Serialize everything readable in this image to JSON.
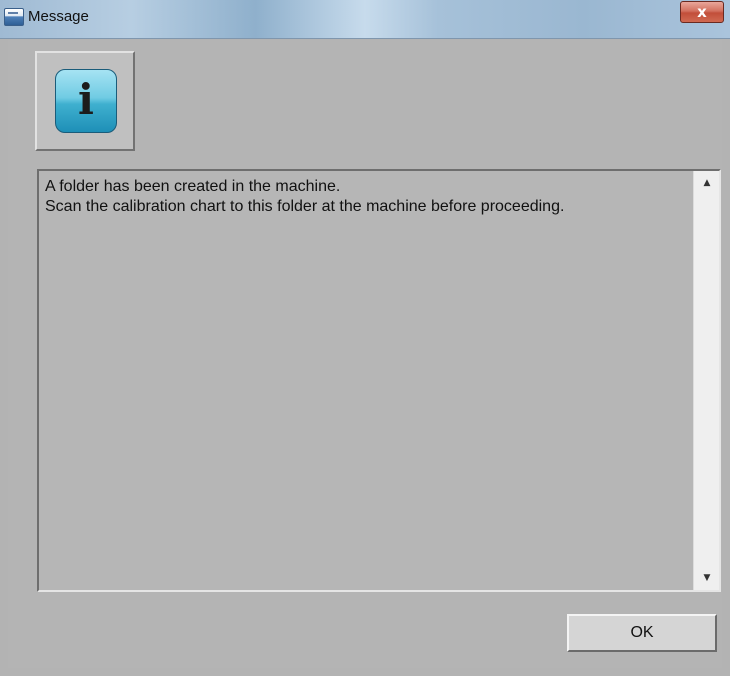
{
  "window": {
    "title": "Message",
    "close_label": "x",
    "app_icon": "dialog-window-icon"
  },
  "dialog": {
    "icon": {
      "name": "information-icon",
      "glyph": "i",
      "color": "#3fb0cf"
    },
    "message_lines": [
      "A folder has been created in the machine.",
      "Scan the calibration chart to this folder at the machine before proceeding."
    ],
    "scroll_up_glyph": "▲",
    "scroll_down_glyph": "▼",
    "ok_label": "OK"
  }
}
